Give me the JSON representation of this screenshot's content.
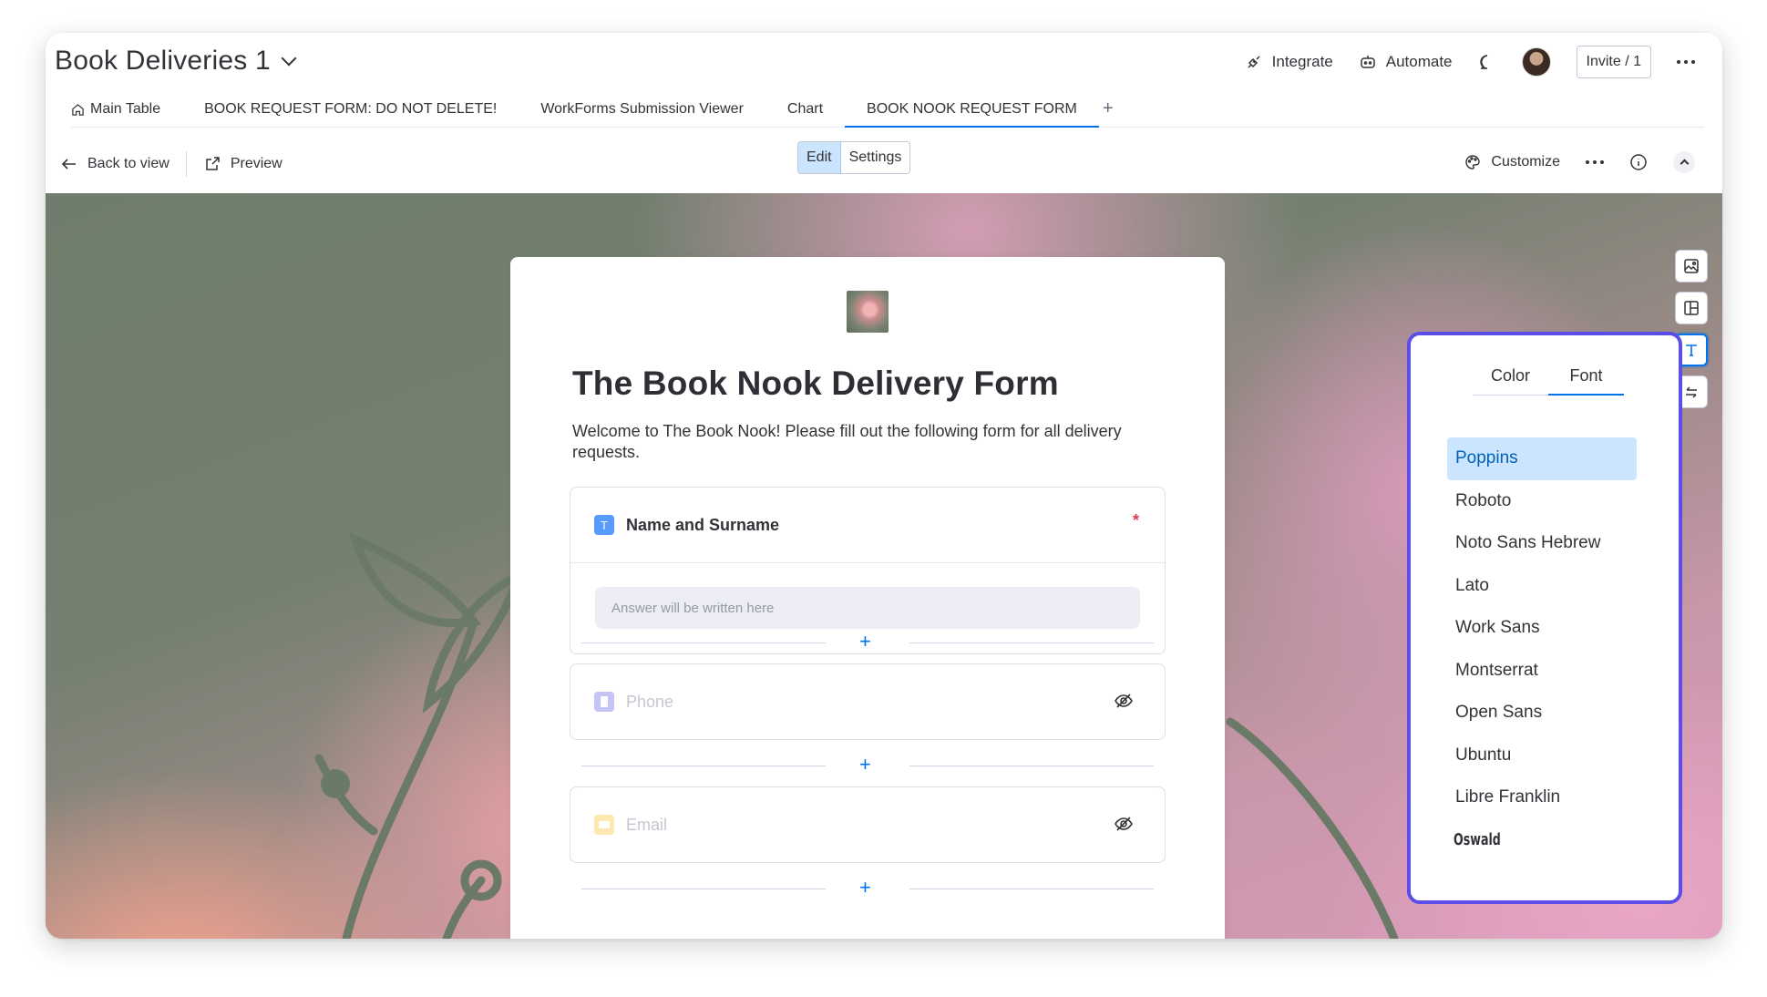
{
  "board": {
    "title": "Book Deliveries 1"
  },
  "header_actions": {
    "integrate": "Integrate",
    "automate": "Automate",
    "invite": "Invite / 1"
  },
  "tabs": [
    {
      "label": "Main Table",
      "icon": "home-icon"
    },
    {
      "label": "BOOK REQUEST FORM: DO NOT DELETE!"
    },
    {
      "label": "WorkForms Submission Viewer"
    },
    {
      "label": "Chart"
    },
    {
      "label": "BOOK NOOK REQUEST FORM",
      "active": true
    }
  ],
  "add_tab": "+",
  "toolbar": {
    "back": "Back to view",
    "preview": "Preview",
    "edit": "Edit",
    "settings": "Settings",
    "customize": "Customize"
  },
  "form": {
    "title": "The Book Nook Delivery Form",
    "description": "Welcome to The Book Nook! Please fill out the following form for all delivery requests.",
    "questions": [
      {
        "label": "Name and Surname",
        "required_mark": "*",
        "placeholder": "Answer will be written here",
        "icon_glyph": "T",
        "icon_color": "#579bfc"
      },
      {
        "label": "Phone",
        "hidden": true,
        "icon_color": "#c4c4f7"
      },
      {
        "label": "Email",
        "hidden": true,
        "icon_color": "#fde9b0"
      }
    ],
    "add_symbol": "+"
  },
  "font_panel": {
    "tabs": [
      "Color",
      "Font"
    ],
    "active_tab": "Font",
    "fonts": [
      "Poppins",
      "Roboto",
      "Noto Sans Hebrew",
      "Lato",
      "Work Sans",
      "Montserrat",
      "Open Sans",
      "Ubuntu",
      "Libre Franklin",
      "Oswald"
    ],
    "selected_font": "Poppins"
  },
  "colors": {
    "accent": "#0073ea",
    "panel_border": "#5b4ee8",
    "selected_bg": "#cce5ff"
  }
}
